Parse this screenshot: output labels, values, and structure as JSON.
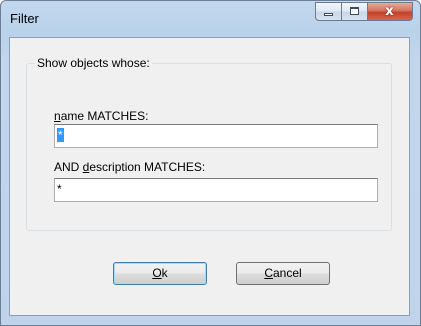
{
  "window": {
    "title": "Filter",
    "minimize_glyph": "",
    "maximize_glyph": "",
    "close_glyph": "x"
  },
  "group": {
    "label": "Show objects whose:"
  },
  "name_field": {
    "label_mnemonic": "n",
    "label_rest": "ame MATCHES:",
    "value": "*"
  },
  "description_field": {
    "label_prefix": "AND ",
    "label_mnemonic": "d",
    "label_rest": "escription MATCHES:",
    "value": "*"
  },
  "buttons": {
    "ok_mnemonic": "O",
    "ok_rest": "k",
    "cancel_mnemonic": "C",
    "cancel_rest": "ancel"
  },
  "icons": {
    "minimize": "minimize-icon",
    "maximize": "maximize-icon",
    "close": "close-icon"
  },
  "colors": {
    "title_bar": "#bfd4eb",
    "client_background": "#f0f0f0",
    "close_button": "#c2432b",
    "selection_highlight": "#3399ff",
    "default_button_border": "#3c7fb1"
  }
}
